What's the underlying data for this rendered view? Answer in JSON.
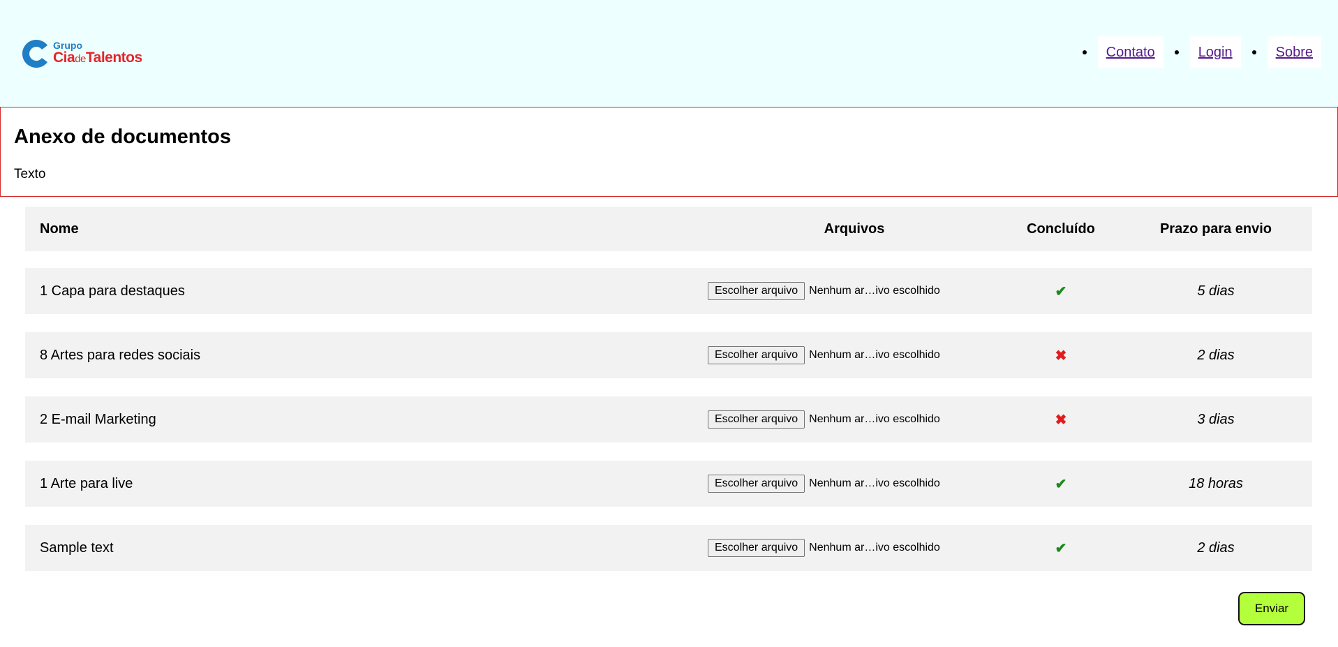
{
  "logo": {
    "grupo": "Grupo",
    "cia": "Cia",
    "de": "de",
    "talentos": "Talentos"
  },
  "nav": {
    "items": [
      {
        "label": "Contato"
      },
      {
        "label": "Login"
      },
      {
        "label": "Sobre"
      }
    ]
  },
  "section": {
    "title": "Anexo de documentos",
    "text": "Texto"
  },
  "table": {
    "headers": {
      "name": "Nome",
      "files": "Arquivos",
      "done": "Concluído",
      "deadline": "Prazo para envio"
    },
    "file_button_label": "Escolher arquivo",
    "file_status": "Nenhum ar…ivo escolhido",
    "rows": [
      {
        "name": "1 Capa para destaques",
        "done": "✔",
        "deadline": "5 dias"
      },
      {
        "name": "8 Artes para redes sociais",
        "done": "✖",
        "deadline": "2 dias"
      },
      {
        "name": "2 E-mail Marketing",
        "done": "✖",
        "deadline": "3 dias"
      },
      {
        "name": "1 Arte para live",
        "done": "✔",
        "deadline": "18 horas"
      },
      {
        "name": "Sample text",
        "done": "✔",
        "deadline": "2 dias"
      }
    ]
  },
  "submit_label": "Enviar",
  "colors": {
    "header_bg": "#eeffff",
    "border_red": "#d42b2b",
    "submit_bg": "#b4ff3c",
    "check_green": "#1a8a1a",
    "cross_red": "#e31b1b"
  }
}
